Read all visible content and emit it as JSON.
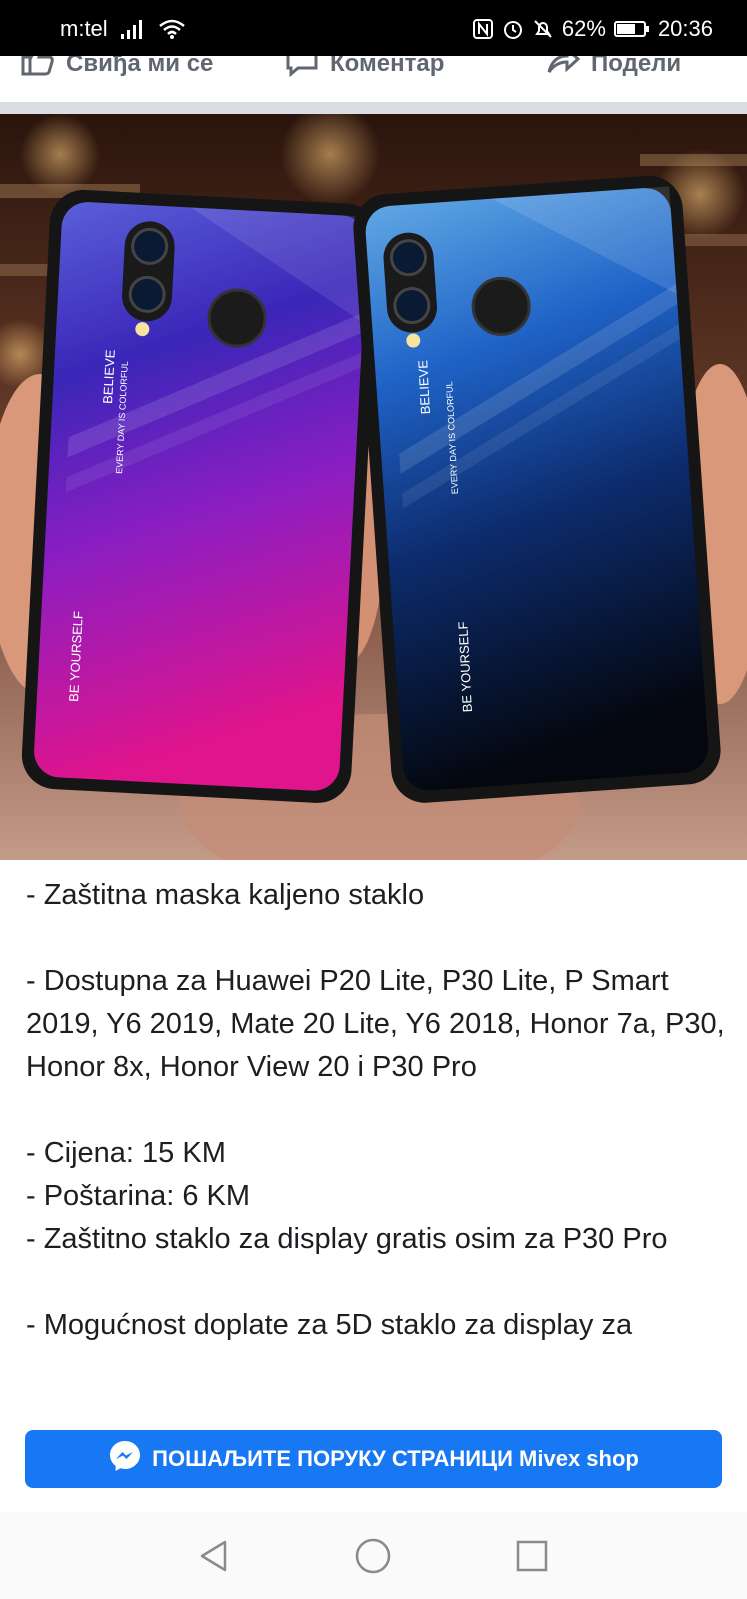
{
  "status_bar": {
    "carrier": "m:tel",
    "battery": "62%",
    "time": "20:36",
    "icons": [
      "signal-icon",
      "wifi-icon",
      "nfc-icon",
      "alarm-icon",
      "mute-icon",
      "battery-icon"
    ]
  },
  "action_bar": {
    "like_label": "Свиђа ми се",
    "comment_label": "Коментар",
    "share_label": "Подели"
  },
  "photo": {
    "left_case": {
      "text_top": "BELIEVE",
      "text_sub": "EVERY DAY IS COLORFUL",
      "text_bottom": "BE YOURSELF",
      "colors": [
        "#5a5fd8",
        "#3a26b8",
        "#8a1ec2",
        "#e0148c"
      ]
    },
    "right_case": {
      "text_top": "BELIEVE",
      "text_sub": "EVERY DAY IS COLORFUL",
      "text_bottom": "BE YOURSELF",
      "colors": [
        "#5fa7e4",
        "#1f63c7",
        "#0d2c6e",
        "#04070f"
      ]
    }
  },
  "post": {
    "line1": "- Zaštitna maska kaljeno staklo",
    "line2": "- Dostupna za Huawei P20 Lite, P30 Lite, P Smart 2019, Y6 2019, Mate 20 Lite, Y6 2018, Honor 7a, P30, Honor 8x, Honor View 20 i P30 Pro",
    "line3": "- Cijena: 15 KM",
    "line4": "- Poštarina: 6 KM",
    "line5": "- Zaštitno staklo za display gratis osim za P30 Pro",
    "line6": "- Mogućnost doplate za 5D staklo za display za"
  },
  "cta": {
    "label": "ПОШАЉИТЕ ПОРУКУ СТРАНИЦИ Mivex shop",
    "color": "#1877f2"
  },
  "nav": {
    "icons": [
      "back-icon",
      "home-icon",
      "recents-icon"
    ]
  }
}
